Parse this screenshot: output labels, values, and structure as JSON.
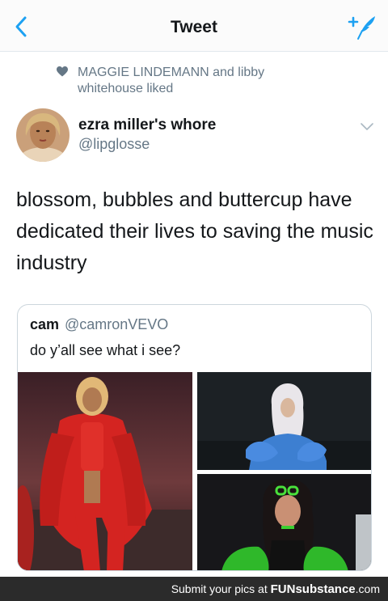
{
  "nav": {
    "title": "Tweet",
    "back_icon": "chevron-left-icon",
    "compose_icon": "compose-tweet-icon",
    "accent": "#1da1f2"
  },
  "social_context": {
    "icon": "heart-icon",
    "text": "MAGGIE LINDEMANN and libby whitehouse liked"
  },
  "tweet": {
    "display_name": "ezra miller's whore",
    "handle": "@lipglosse",
    "text": "blossom, bubbles and buttercup have dedicated their lives to saving the music industry"
  },
  "quote": {
    "display_name": "cam",
    "handle": "@camronVEVO",
    "text": "do y’all see what i see?",
    "images": [
      {
        "name": "performer-red-outfit-photo",
        "dominant_color": "#c8201d"
      },
      {
        "name": "performer-blue-outfit-photo",
        "dominant_color": "#3d7fd1"
      },
      {
        "name": "performer-green-outfit-photo",
        "dominant_color": "#2fb82a"
      }
    ]
  },
  "watermark": {
    "prefix": "Submit your pics at ",
    "brand": "FUNsubstance",
    "suffix": ".com"
  },
  "colors": {
    "secondary_text": "#657786",
    "border": "#ccd6dd",
    "footer_bg": "#2b2b2b"
  }
}
